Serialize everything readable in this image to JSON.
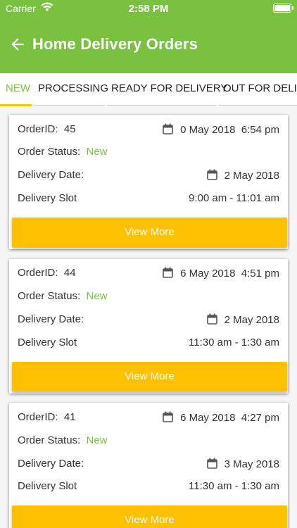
{
  "status_bar": {
    "carrier": "Carrier",
    "time": "2:58 PM"
  },
  "header": {
    "title": "Home Delivery Orders"
  },
  "tabs": [
    {
      "label": "NEW",
      "active": true
    },
    {
      "label": "PROCESSING",
      "active": false
    },
    {
      "label": "READY FOR DELIVERY",
      "active": false
    },
    {
      "label": "OUT FOR DELIVERY",
      "active": false
    }
  ],
  "labels": {
    "order_id": "OrderID:",
    "order_status": "Order Status:",
    "delivery_date": "Delivery Date:",
    "delivery_slot": "Delivery Slot",
    "view_more": "View More"
  },
  "orders": [
    {
      "id": "45",
      "created": "0 May 2018  6:54 pm",
      "status": "New",
      "delivery_date": "2 May 2018",
      "slot": "9:00 am - 11:01 am"
    },
    {
      "id": "44",
      "created": "6 May 2018  4:51 pm",
      "status": "New",
      "delivery_date": "2 May 2018",
      "slot": "11:30 am - 1:30 am"
    },
    {
      "id": "41",
      "created": "6 May 2018  4:27 pm",
      "status": "New",
      "delivery_date": "3 May 2018",
      "slot": "11:30 am - 1:30 am"
    }
  ],
  "colors": {
    "header": "#7ac142",
    "accent": "#f5c400",
    "button": "#fec000",
    "status": "#7ac142"
  }
}
